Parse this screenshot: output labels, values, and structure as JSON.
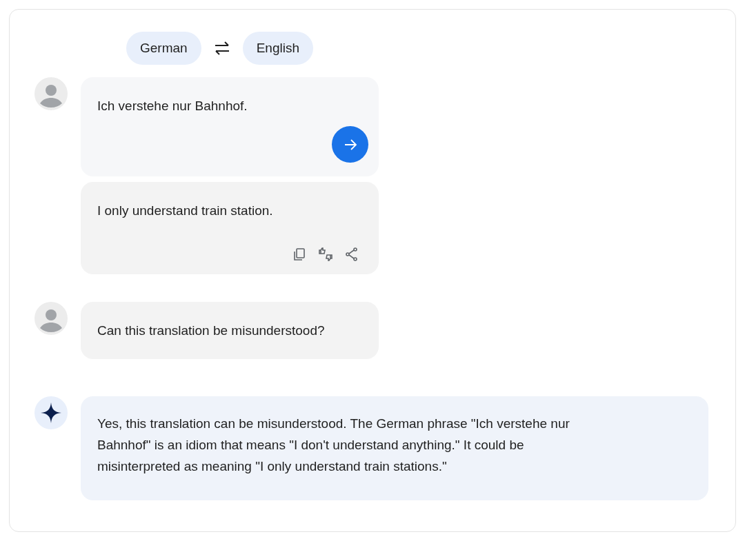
{
  "languages": {
    "source": "German",
    "target": "English"
  },
  "messages": [
    {
      "kind": "input",
      "text": "Ich verstehe nur Bahnhof."
    },
    {
      "kind": "translation",
      "text": "I only understand train station."
    },
    {
      "kind": "question",
      "text": "Can this translation be misunderstood?"
    },
    {
      "kind": "answer",
      "text": "Yes, this translation can be misunderstood. The German phrase \"Ich verstehe nur Bahnhof\" is an idiom that means \"I don't understand anything.\" It could be misinterpreted as meaning \"I only understand train stations.\""
    }
  ]
}
